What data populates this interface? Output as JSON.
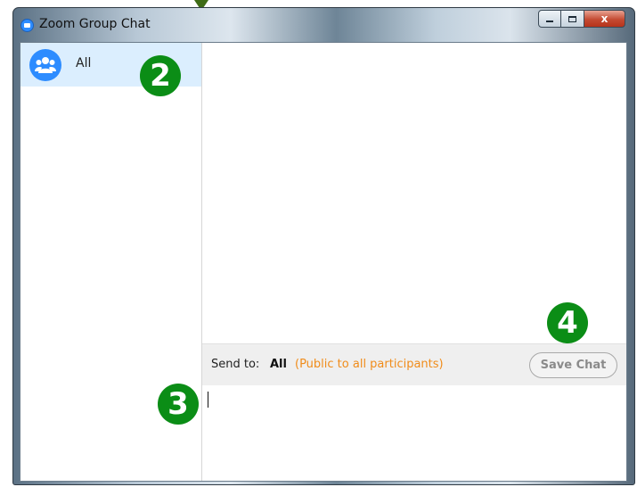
{
  "window": {
    "title": "Zoom Group Chat",
    "controls": {
      "minimize": "",
      "maximize": "",
      "close": "x"
    }
  },
  "sidebar": {
    "items": [
      {
        "label": "All",
        "icon": "group-icon",
        "selected": true
      }
    ]
  },
  "send_bar": {
    "send_to_label": "Send to:",
    "send_to_value": "All",
    "note": "(Public to all participants)",
    "save_label": "Save Chat"
  },
  "input": {
    "placeholder": "",
    "value": ""
  },
  "callouts": [
    "2",
    "3",
    "4"
  ],
  "colors": {
    "zoom_blue": "#2d8cff",
    "selected_bg": "#dbeefe",
    "note_orange": "#f08c1a",
    "callout_green": "#0b8d16"
  }
}
